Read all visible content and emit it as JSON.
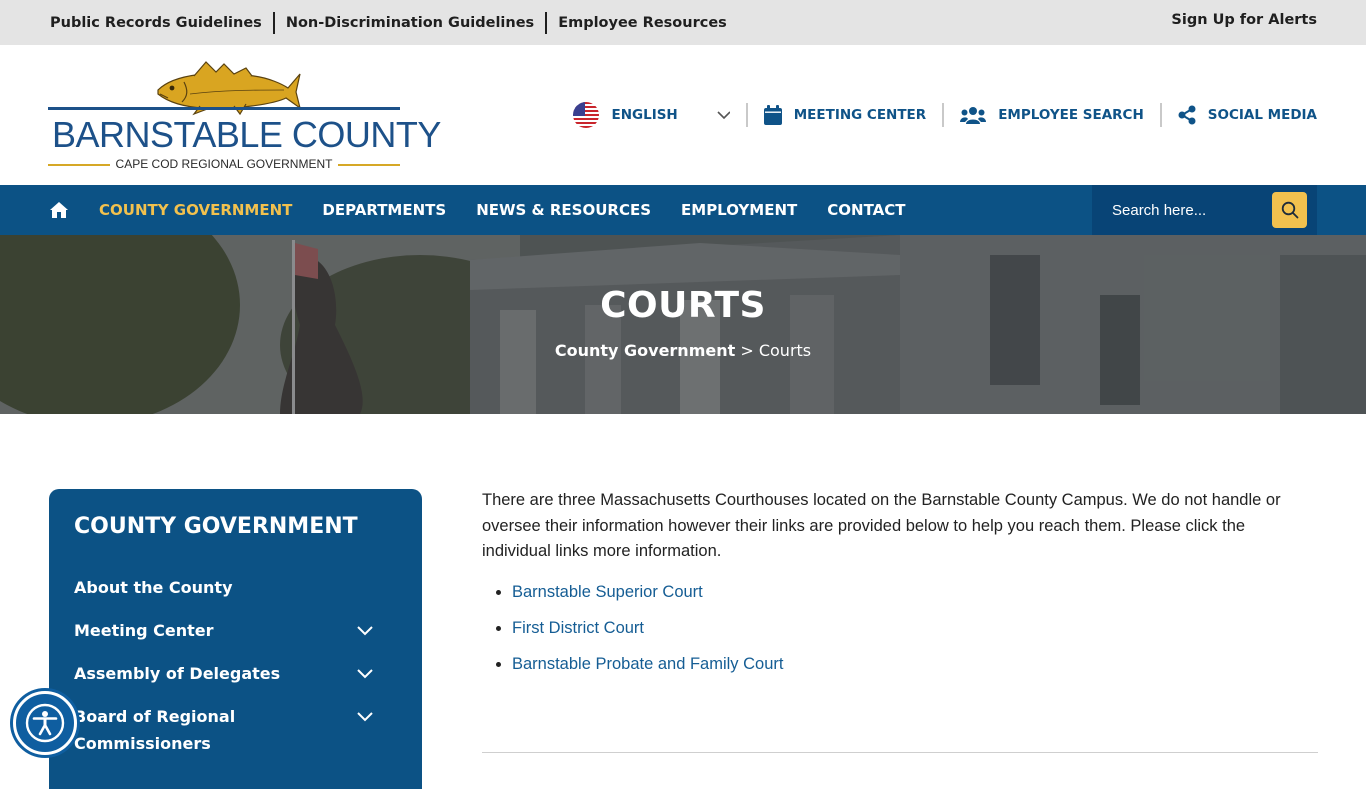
{
  "top_bar": {
    "links": [
      "Public Records Guidelines",
      "Non-Discrimination Guidelines",
      "Employee Resources"
    ],
    "alerts": "Sign Up for Alerts"
  },
  "logo": {
    "title": "BARNSTABLE COUNTY",
    "subtitle": "CAPE COD REGIONAL GOVERNMENT"
  },
  "header_nav": {
    "language": "ENGLISH",
    "meeting_center": "MEETING CENTER",
    "employee_search": "EMPLOYEE SEARCH",
    "social_media": "SOCIAL MEDIA"
  },
  "main_nav": {
    "items": [
      "COUNTY GOVERNMENT",
      "DEPARTMENTS",
      "NEWS & RESOURCES",
      "EMPLOYMENT",
      "CONTACT"
    ],
    "active": "COUNTY GOVERNMENT",
    "search_placeholder": "Search here..."
  },
  "hero": {
    "title": "COURTS",
    "breadcrumb_parent": "County Government",
    "breadcrumb_separator": " > ",
    "breadcrumb_current": "Courts"
  },
  "sidebar": {
    "title": "COUNTY GOVERNMENT",
    "items": [
      "About the County",
      "Meeting Center",
      "Assembly of Delegates",
      "Board of Regional Commissioners"
    ]
  },
  "content": {
    "intro": "There are three Massachusetts Courthouses located on the Barnstable County Campus. We do not handle or oversee their information however their links are provided below to help you reach them. Please click the individual links more information.",
    "courts": [
      "Barnstable Superior Court",
      "First District Court",
      "Barnstable Probate and Family Court"
    ]
  },
  "colors": {
    "primary_blue": "#0c5285",
    "accent_gold": "#f2c14e",
    "link_blue": "#155d94"
  },
  "icons": {
    "home": "home-icon",
    "language": "us-flag-icon",
    "meeting": "calendar-icon",
    "employees": "users-icon",
    "social": "share-icon",
    "search": "search-icon",
    "accessibility": "accessibility-icon"
  }
}
